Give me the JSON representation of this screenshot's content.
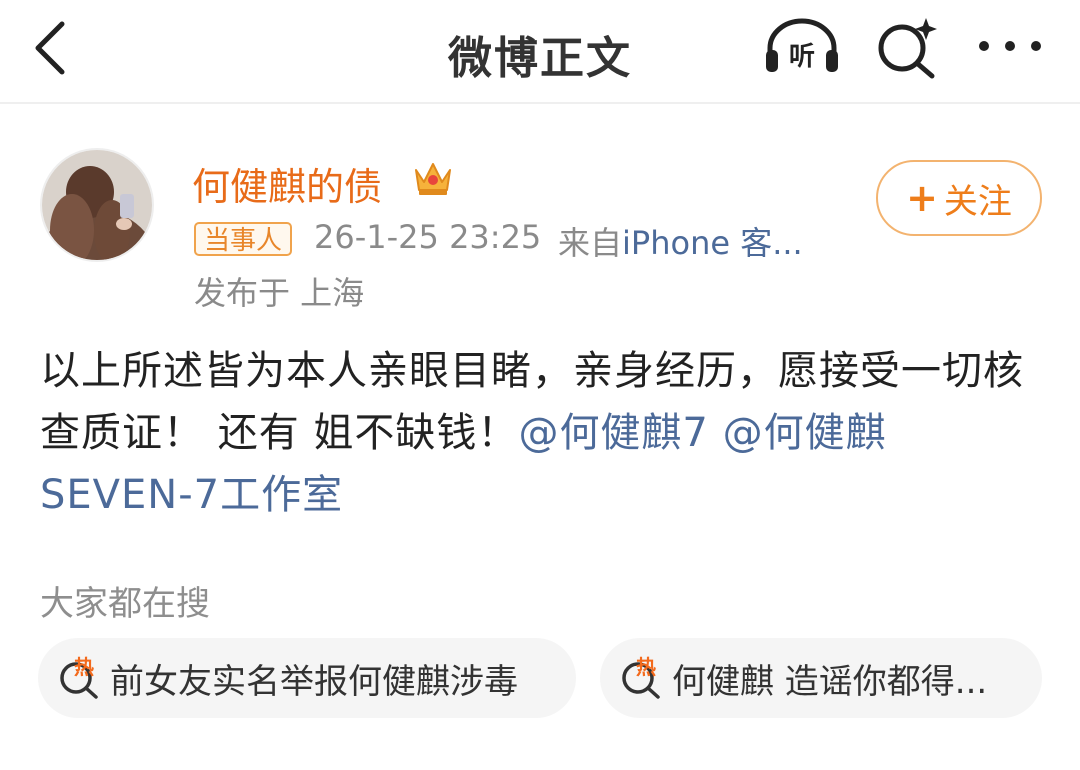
{
  "nav": {
    "title": "微博正文",
    "listen_label": "听"
  },
  "post": {
    "author": "何健麒的债",
    "badge": "当事人",
    "time": "26-1-25 23:25",
    "source_prefix": "来自",
    "source_device": "iPhone 客...",
    "location": "发布于 上海",
    "follow_plus": "+",
    "follow_label": "关注",
    "text_body": "以上所述皆为本人亲眼目睹，亲身经历，愿接受一切核查质证！ 还有 姐不缺钱！",
    "mentions": [
      "@何健麒7",
      "@何健麒SEVEN-7工作室"
    ]
  },
  "trending": {
    "title": "大家都在搜",
    "hot_label": "热",
    "items": [
      "前女友实名举报何健麒涉毒",
      "何健麒 造谣你都得..."
    ]
  },
  "colors": {
    "username": "#e86b19",
    "mention": "#4c6a99",
    "follow_border": "#f3b36f",
    "chip_bg": "#f5f5f5"
  },
  "icons": [
    "back-arrow-icon",
    "headphones-icon",
    "search-sparkle-icon",
    "more-icon",
    "crown-icon",
    "hot-search-icon"
  ]
}
